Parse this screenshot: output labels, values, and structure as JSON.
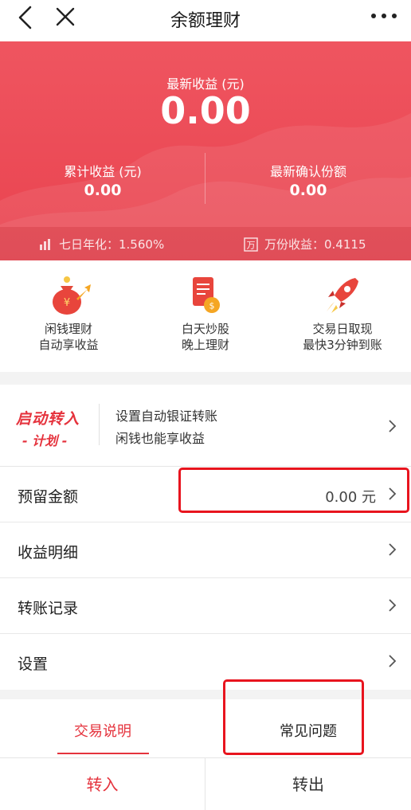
{
  "nav": {
    "title": "余额理财",
    "icons": [
      "back-icon",
      "close-icon",
      "more-icon"
    ]
  },
  "hero": {
    "latest_label": "最新收益 (元)",
    "latest_value": "0.00",
    "cumulative_label": "累计收益 (元)",
    "cumulative_value": "0.00",
    "confirmed_label": "最新确认份额",
    "confirmed_value": "0.00",
    "seven_day_yield": "七日年化：1.560%",
    "per_10k_income": "万份收益：0.4115",
    "seven_day_icon_text": "",
    "per_10k_icon_text": "万"
  },
  "features": [
    {
      "line1": "闲钱理财",
      "line2": "自动享收益",
      "icon": "money-bag-icon"
    },
    {
      "line1": "白天炒股",
      "line2": "晚上理财",
      "icon": "document-coin-icon"
    },
    {
      "line1": "交易日取现",
      "line2": "最快3分钟到账",
      "icon": "rocket-icon"
    }
  ],
  "auto_transfer": {
    "logo_line1": "启动转入",
    "logo_line2": "- 计划 -",
    "text_line1": "设置自动银证转账",
    "text_line2": "闲钱也能享收益"
  },
  "rows": {
    "reserve_label": "预留金额",
    "reserve_value": "0.00 元",
    "income_detail": "收益明细",
    "transfer_record": "转账记录",
    "settings": "设置"
  },
  "tabs": {
    "trade_info": "交易说明",
    "faq": "常见问题",
    "active": "trade_info"
  },
  "bottom": {
    "transfer_in": "转入",
    "transfer_out": "转出"
  },
  "colors": {
    "brand_red": "#e5333d",
    "hero_red": "#ef5560",
    "annotation_red": "#e8141e"
  }
}
